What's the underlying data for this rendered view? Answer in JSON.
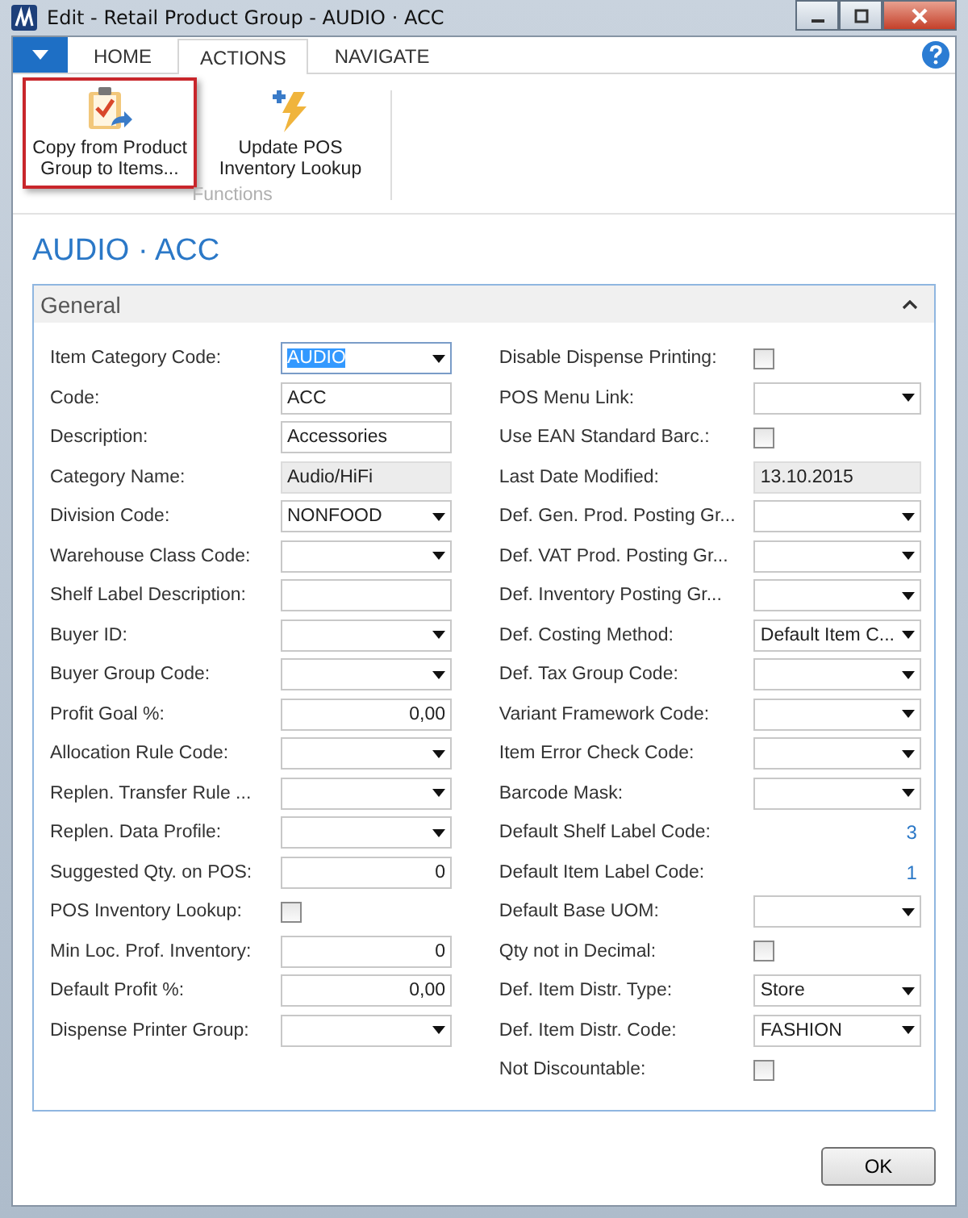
{
  "window": {
    "title": "Edit - Retail Product Group - AUDIO · ACC"
  },
  "tabs": [
    {
      "label": "HOME",
      "selected": false
    },
    {
      "label": "ACTIONS",
      "selected": true
    },
    {
      "label": "NAVIGATE",
      "selected": false
    }
  ],
  "ribbon": {
    "actions": [
      {
        "label": "Copy from Product Group to Items...",
        "kind": "copy",
        "selected": true
      },
      {
        "label": "Update POS Inventory Lookup",
        "kind": "update",
        "selected": false
      }
    ],
    "group_label": "Functions"
  },
  "page_title": "AUDIO · ACC",
  "section": {
    "title": "General",
    "expanded": true
  },
  "left_fields": [
    {
      "label": "Item Category Code:",
      "kind": "dropdown",
      "value": "AUDIO",
      "focused": true
    },
    {
      "label": "Code:",
      "kind": "text",
      "value": "ACC",
      "focused": false
    },
    {
      "label": "Description:",
      "kind": "text",
      "value": "Accessories",
      "focused": false
    },
    {
      "label": "Category Name:",
      "kind": "readonly",
      "value": "Audio/HiFi",
      "focused": false
    },
    {
      "label": "Division Code:",
      "kind": "dropdown",
      "value": "NONFOOD",
      "focused": false
    },
    {
      "label": "Warehouse Class Code:",
      "kind": "dropdown",
      "focused": false
    },
    {
      "label": "Shelf Label Description:",
      "kind": "text",
      "focused": false
    },
    {
      "label": "Buyer ID:",
      "kind": "dropdown",
      "focused": false
    },
    {
      "label": "Buyer Group Code:",
      "kind": "dropdown",
      "focused": false
    },
    {
      "label": "Profit Goal %:",
      "kind": "number",
      "value": "0,00",
      "focused": false
    },
    {
      "label": "Allocation Rule Code:",
      "kind": "dropdown",
      "focused": false
    },
    {
      "label": "Replen. Transfer Rule ...",
      "kind": "dropdown",
      "focused": false
    },
    {
      "label": "Replen. Data Profile:",
      "kind": "dropdown",
      "focused": false
    },
    {
      "label": "Suggested Qty. on POS:",
      "kind": "number",
      "value": "0",
      "focused": false
    },
    {
      "label": "POS Inventory Lookup:",
      "kind": "checkbox",
      "checked": false,
      "focused": false
    },
    {
      "label": "Min Loc. Prof. Inventory:",
      "kind": "number",
      "value": "0",
      "focused": false
    },
    {
      "label": "Default Profit %:",
      "kind": "number",
      "value": "0,00",
      "focused": false
    },
    {
      "label": "Dispense Printer Group:",
      "kind": "dropdown",
      "focused": false
    }
  ],
  "right_fields": [
    {
      "label": "Disable Dispense Printing:",
      "kind": "checkbox",
      "checked": false,
      "focused": false
    },
    {
      "label": "POS Menu Link:",
      "kind": "dropdown",
      "focused": false
    },
    {
      "label": "Use EAN Standard Barc.:",
      "kind": "checkbox",
      "checked": false,
      "focused": false
    },
    {
      "label": "Last Date Modified:",
      "kind": "readonly",
      "value": "13.10.2015",
      "focused": false
    },
    {
      "label": "Def. Gen. Prod. Posting Gr...",
      "kind": "dropdown",
      "focused": false
    },
    {
      "label": "Def. VAT Prod. Posting Gr...",
      "kind": "dropdown",
      "focused": false
    },
    {
      "label": "Def. Inventory Posting Gr...",
      "kind": "dropdown",
      "focused": false
    },
    {
      "label": "Def. Costing Method:",
      "kind": "dropdown",
      "value": "Default Item C...",
      "focused": false
    },
    {
      "label": "Def. Tax Group Code:",
      "kind": "dropdown",
      "focused": false
    },
    {
      "label": "Variant Framework Code:",
      "kind": "dropdown",
      "focused": false
    },
    {
      "label": "Item Error Check Code:",
      "kind": "dropdown",
      "focused": false
    },
    {
      "label": "Barcode Mask:",
      "kind": "dropdown",
      "focused": false
    },
    {
      "label": "Default Shelf Label Code:",
      "kind": "link",
      "value": "3",
      "focused": false
    },
    {
      "label": "Default Item Label Code:",
      "kind": "link",
      "value": "1",
      "focused": false
    },
    {
      "label": "Default Base UOM:",
      "kind": "dropdown",
      "focused": false
    },
    {
      "label": "Qty not in Decimal:",
      "kind": "checkbox",
      "checked": false,
      "focused": false
    },
    {
      "label": "Def. Item Distr. Type:",
      "kind": "dropdown",
      "value": "Store",
      "focused": false
    },
    {
      "label": "Def. Item Distr. Code:",
      "kind": "dropdown",
      "value": "FASHION",
      "focused": false
    },
    {
      "label": "Not Discountable:",
      "kind": "checkbox",
      "checked": false,
      "focused": false
    }
  ],
  "buttons": [
    "OK"
  ]
}
